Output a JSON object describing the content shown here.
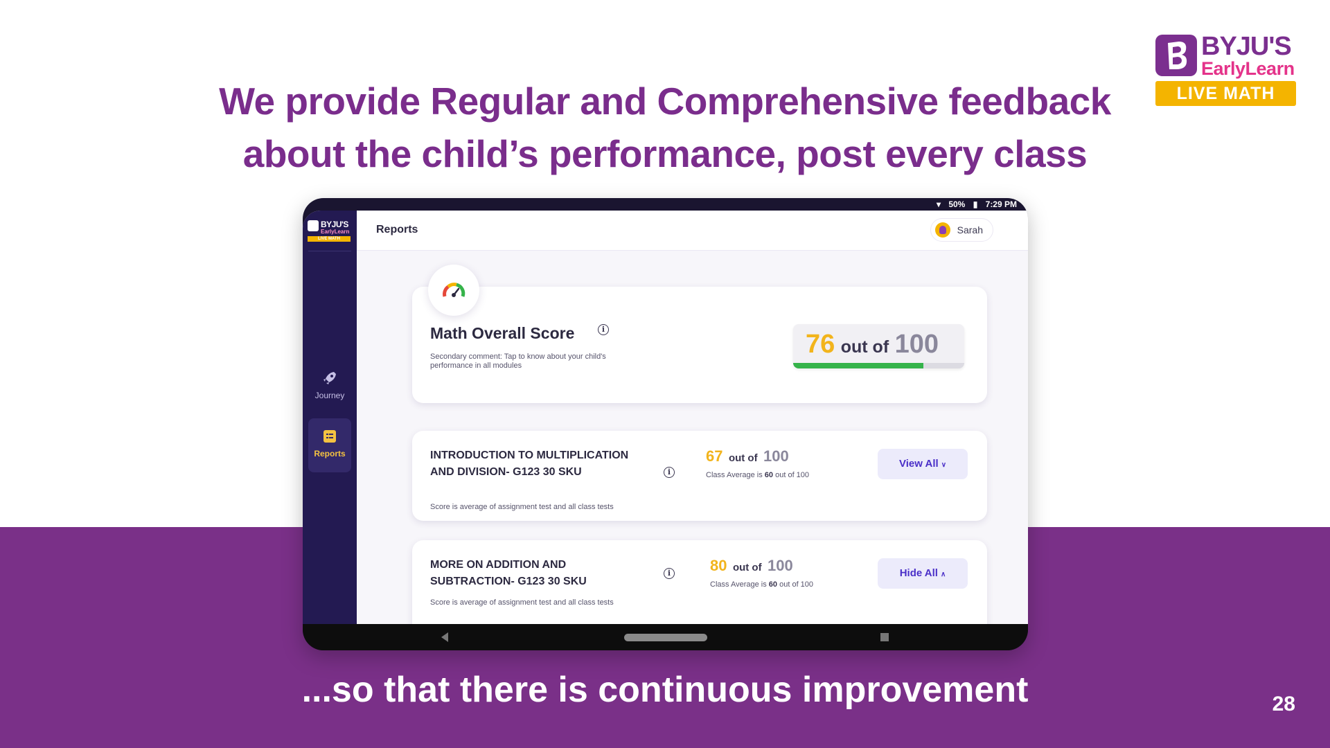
{
  "slide": {
    "headline_line1": "We provide Regular and Comprehensive feedback",
    "headline_line2": "about the child’s performance, post every class",
    "footer_text": "...so that there is continuous improvement",
    "page_number": "28"
  },
  "brand": {
    "name": "BYJU'S",
    "sub": "EarlyLearn",
    "tag": "LIVE MATH",
    "colors": {
      "purple": "#7b2f8f",
      "pink": "#e4338a",
      "yellow": "#f4b400"
    }
  },
  "device": {
    "status": {
      "battery": "50%",
      "time": "7:29 PM"
    }
  },
  "app": {
    "sidebar": {
      "logo_name": "BYJU'S",
      "logo_sub": "EarlyLearn",
      "logo_tag": "LIVE MATH",
      "items": [
        {
          "label": "Journey",
          "icon": "rocket-icon"
        },
        {
          "label": "Reports",
          "icon": "report-icon",
          "active": true
        }
      ]
    },
    "topbar": {
      "title": "Reports",
      "user": "Sarah"
    },
    "overall": {
      "title": "Math Overall Score",
      "comment": "Secondary comment: Tap to know about your child's performance in all modules",
      "score": "76",
      "of_label": "out of",
      "max": "100",
      "progress_fraction": 0.76
    },
    "modules": [
      {
        "title": "INTRODUCTION TO MULTIPLICATION AND DIVISION- G123 30 SKU",
        "note": "Score is average of assignment test and all class tests",
        "score": "67",
        "of_label": "out of",
        "max": "100",
        "avg_prefix": "Class Average is",
        "avg_value": "60",
        "avg_suffix": "out of 100",
        "button": "View All"
      },
      {
        "title": "MORE ON ADDITION AND SUBTRACTION- G123 30 SKU",
        "note": "Score is average of assignment test and all class tests",
        "score": "80",
        "of_label": "out of",
        "max": "100",
        "avg_prefix": "Class Average is",
        "avg_value": "60",
        "avg_suffix": "out of 100",
        "button": "Hide All"
      }
    ]
  }
}
